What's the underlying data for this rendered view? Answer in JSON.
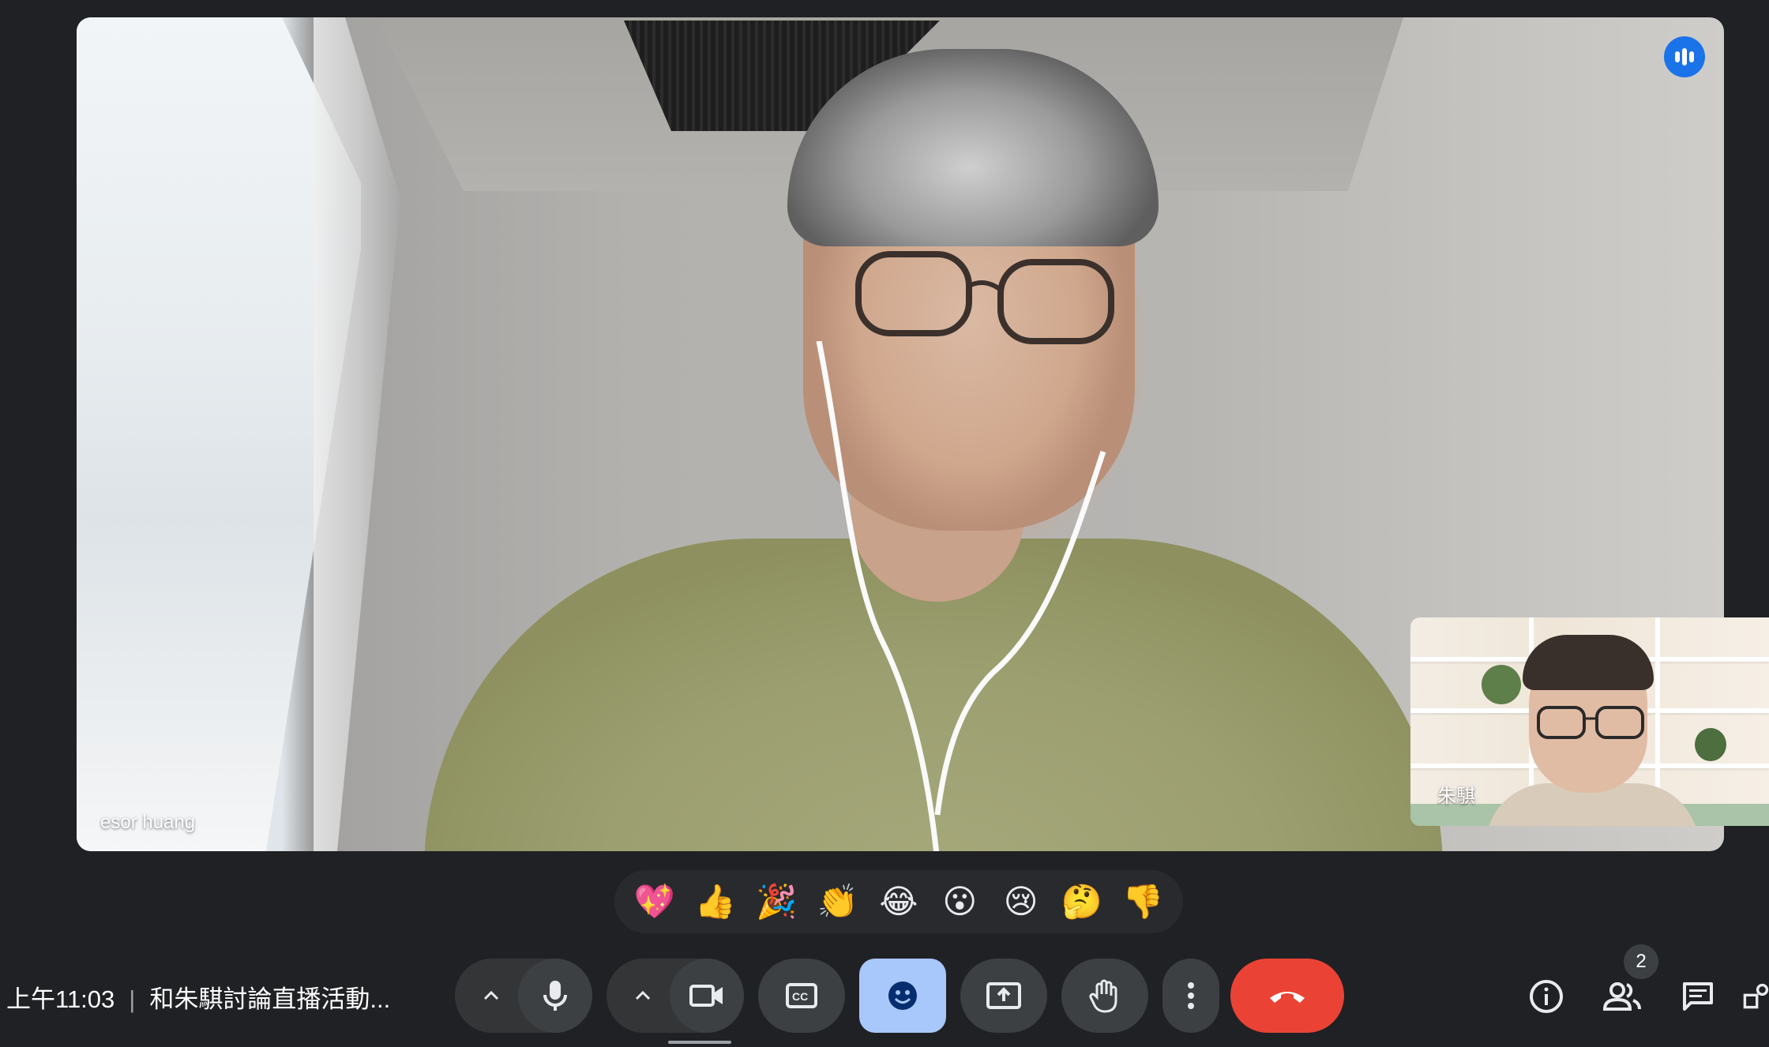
{
  "main_video": {
    "participant_name": "esor huang",
    "speaking_icon": "audio-level-icon",
    "accent": "#1a73e8"
  },
  "self_view": {
    "participant_name": "朱騏"
  },
  "reactions": [
    {
      "name": "sparkling-heart",
      "glyph": "💖"
    },
    {
      "name": "thumbs-up",
      "glyph": "👍"
    },
    {
      "name": "party-popper",
      "glyph": "🎉"
    },
    {
      "name": "clapping-hands",
      "glyph": "👏"
    },
    {
      "name": "tears-of-joy",
      "glyph": "😂"
    },
    {
      "name": "surprised",
      "glyph": "😮"
    },
    {
      "name": "crying",
      "glyph": "😢"
    },
    {
      "name": "thinking",
      "glyph": "🤔"
    },
    {
      "name": "thumbs-down",
      "glyph": "👎"
    }
  ],
  "meeting": {
    "time": "上午11:03",
    "separator": "|",
    "title": "和朱騏討論直播活動..."
  },
  "controls": {
    "mic_icon": "microphone-icon",
    "camera_icon": "video-camera-icon",
    "captions_icon": "closed-captions-icon",
    "emoji_icon": "emoji-smile-icon",
    "present_icon": "present-screen-icon",
    "raise_hand_icon": "raise-hand-icon",
    "more_icon": "more-vert-icon",
    "end_call_icon": "end-call-icon",
    "end_call_color": "#ea4335",
    "emoji_active_color": "#a8c7fa"
  },
  "side_panel": {
    "info_icon": "info-icon",
    "people_icon": "people-icon",
    "people_count": "2",
    "chat_icon": "chat-icon"
  }
}
